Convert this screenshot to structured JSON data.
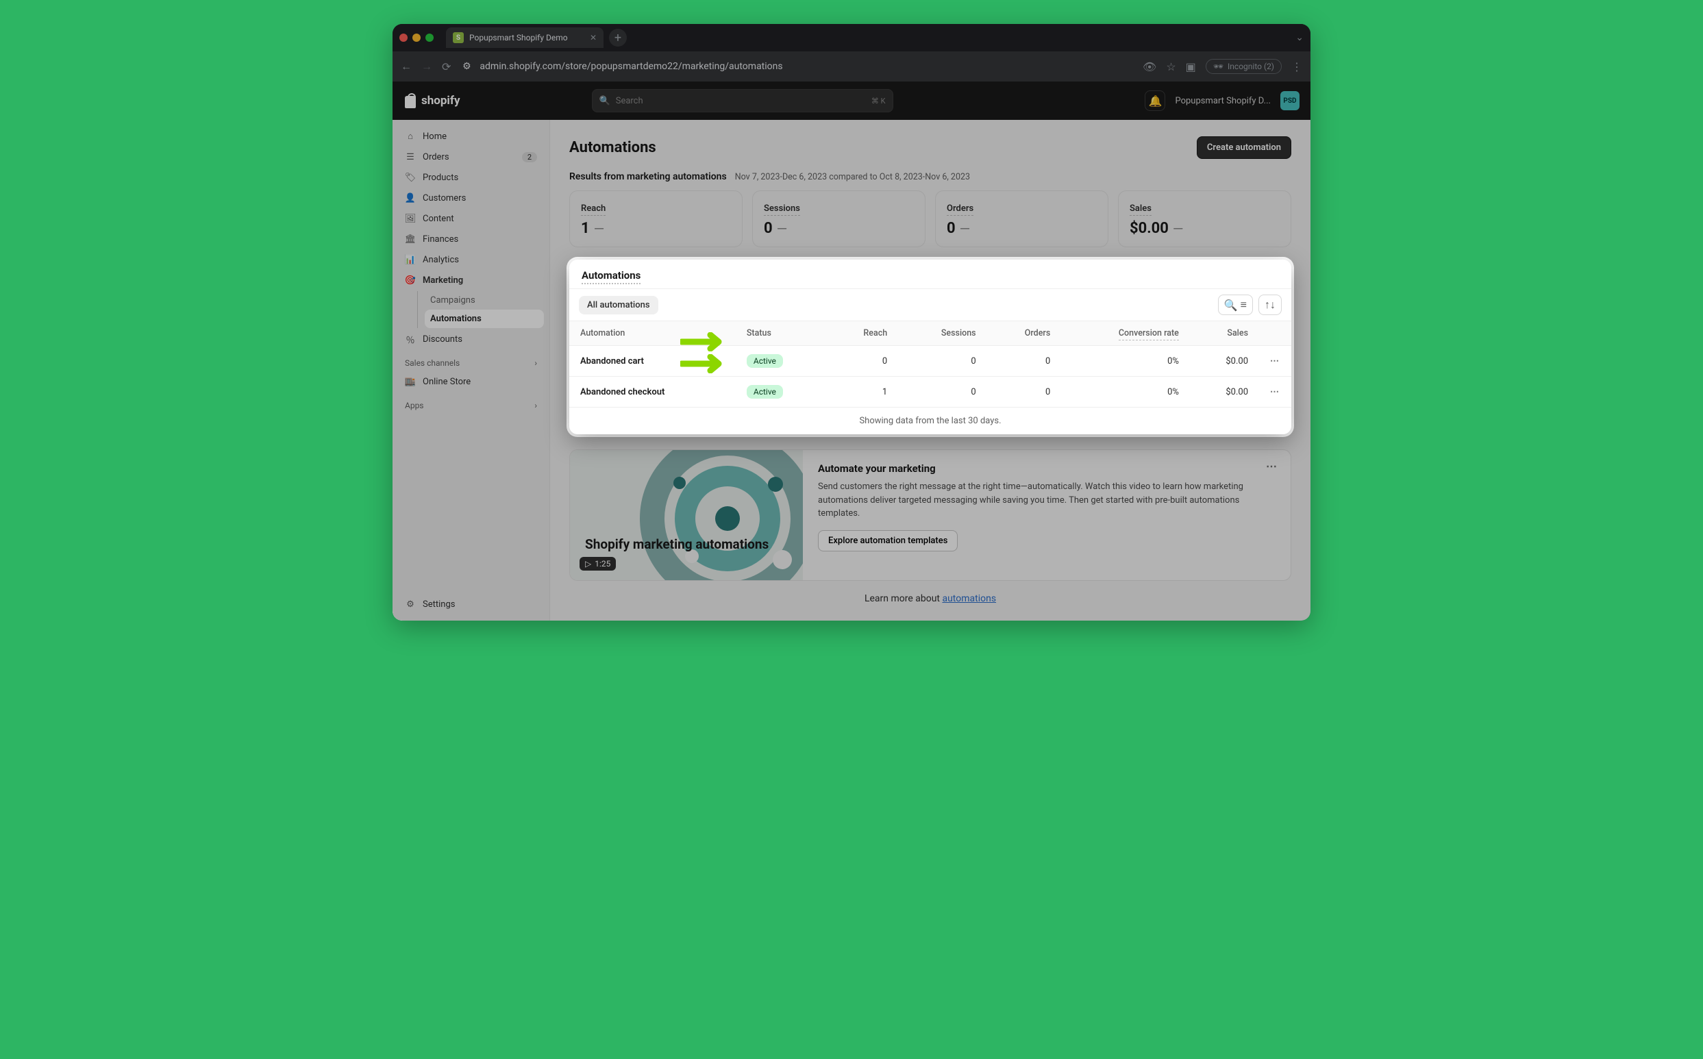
{
  "browser": {
    "tab_title": "Popupsmart Shopify Demo",
    "url": "admin.shopify.com/store/popupsmartdemo22/marketing/automations",
    "incognito_label": "Incognito (2)"
  },
  "topbar": {
    "brand": "shopify",
    "search_placeholder": "Search",
    "search_shortcut": "⌘ K",
    "store_name": "Popupsmart Shopify D...",
    "store_initials": "PSD"
  },
  "sidebar": {
    "items": [
      {
        "label": "Home"
      },
      {
        "label": "Orders",
        "badge": "2"
      },
      {
        "label": "Products"
      },
      {
        "label": "Customers"
      },
      {
        "label": "Content"
      },
      {
        "label": "Finances"
      },
      {
        "label": "Analytics"
      },
      {
        "label": "Marketing"
      },
      {
        "label": "Discounts"
      }
    ],
    "marketing_sub": [
      {
        "label": "Campaigns"
      },
      {
        "label": "Automations"
      }
    ],
    "channels_heading": "Sales channels",
    "channels": [
      {
        "label": "Online Store"
      }
    ],
    "apps_heading": "Apps",
    "settings": "Settings"
  },
  "page": {
    "title": "Automations",
    "create_btn": "Create automation",
    "results_label": "Results from marketing automations",
    "date_range": "Nov 7, 2023-Dec 6, 2023 compared to Oct 8, 2023-Nov 6, 2023"
  },
  "metrics": [
    {
      "label": "Reach",
      "value": "1"
    },
    {
      "label": "Sessions",
      "value": "0"
    },
    {
      "label": "Orders",
      "value": "0"
    },
    {
      "label": "Sales",
      "value": "$0.00"
    }
  ],
  "card": {
    "heading": "Automations",
    "filter_chip": "All automations",
    "columns": {
      "automation": "Automation",
      "status": "Status",
      "reach": "Reach",
      "sessions": "Sessions",
      "orders": "Orders",
      "conv": "Conversion rate",
      "sales": "Sales"
    },
    "rows": [
      {
        "name": "Abandoned cart",
        "status": "Active",
        "reach": "0",
        "sessions": "0",
        "orders": "0",
        "conv": "0%",
        "sales": "$0.00"
      },
      {
        "name": "Abandoned checkout",
        "status": "Active",
        "reach": "1",
        "sessions": "0",
        "orders": "0",
        "conv": "0%",
        "sales": "$0.00"
      }
    ],
    "footer": "Showing data from the last 30 days."
  },
  "promo": {
    "video_title": "Shopify marketing automations",
    "duration": "1:25",
    "heading": "Automate your marketing",
    "body": "Send customers the right message at the right time—automatically. Watch this video to learn how marketing automations deliver targeted messaging while saving you time. Then get started with pre-built automations templates.",
    "cta": "Explore automation templates"
  },
  "learn_more": {
    "prefix": "Learn more about ",
    "link": "automations"
  }
}
